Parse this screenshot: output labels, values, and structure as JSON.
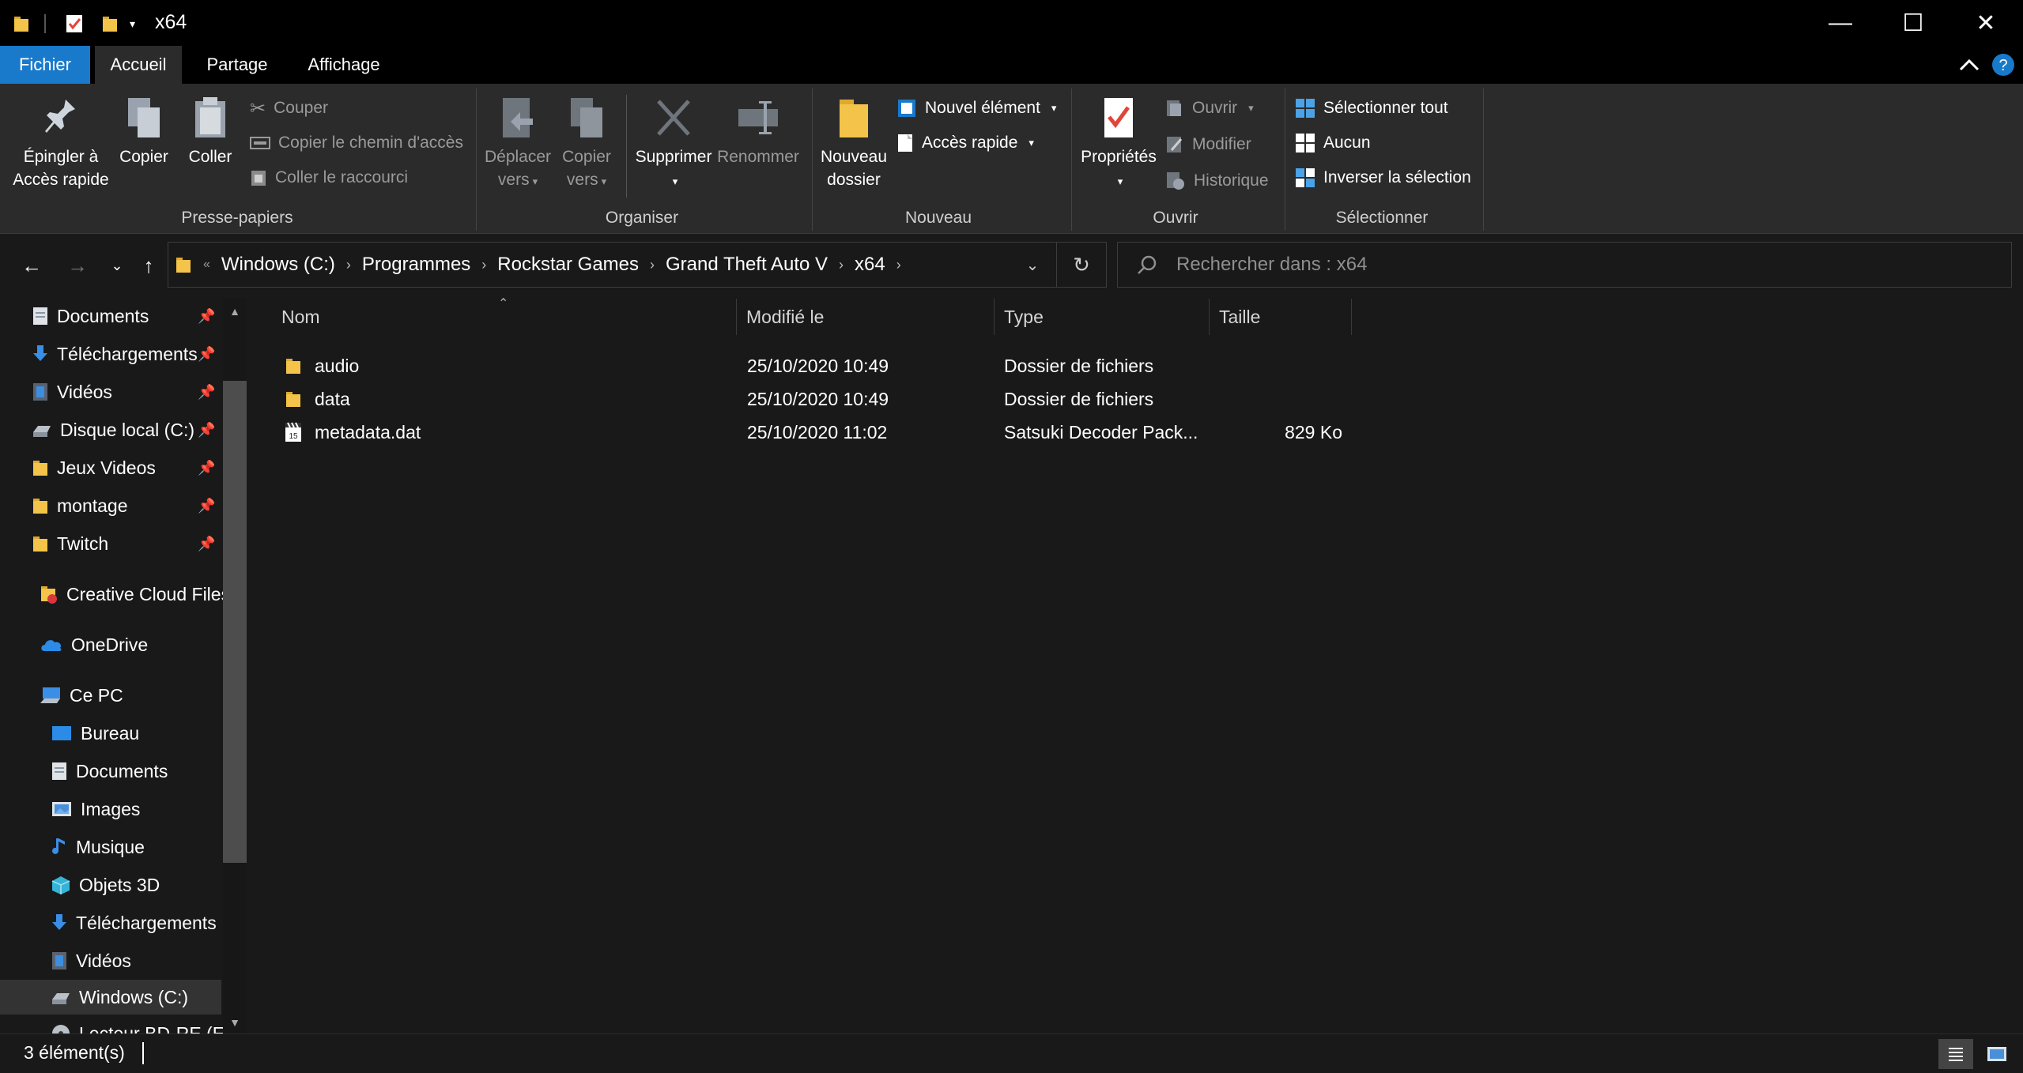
{
  "window": {
    "title": "x64",
    "minimize": "—",
    "maximize": "☐",
    "close": "✕"
  },
  "tabs": {
    "file": "Fichier",
    "home": "Accueil",
    "share": "Partage",
    "view": "Affichage"
  },
  "ribbon": {
    "clipboard": {
      "label": "Presse-papiers",
      "pin_line1": "Épingler à",
      "pin_line2": "Accès rapide",
      "copy": "Copier",
      "paste": "Coller",
      "cut": "Couper",
      "copy_path": "Copier le chemin d'accès",
      "paste_shortcut": "Coller le raccourci"
    },
    "organize": {
      "label": "Organiser",
      "move_line1": "Déplacer",
      "move_line2": "vers",
      "copyto_line1": "Copier",
      "copyto_line2": "vers",
      "delete": "Supprimer",
      "rename": "Renommer"
    },
    "new": {
      "label": "Nouveau",
      "folder_line1": "Nouveau",
      "folder_line2": "dossier",
      "new_item": "Nouvel élément",
      "easy_access": "Accès rapide"
    },
    "open": {
      "label": "Ouvrir",
      "properties": "Propriétés",
      "open": "Ouvrir",
      "edit": "Modifier",
      "history": "Historique"
    },
    "select": {
      "label": "Sélectionner",
      "select_all": "Sélectionner tout",
      "select_none": "Aucun",
      "invert": "Inverser la sélection"
    }
  },
  "address": {
    "crumbs": [
      "Windows (C:)",
      "Programmes",
      "Rockstar Games",
      "Grand Theft Auto V",
      "x64"
    ],
    "search_placeholder": "Rechercher dans : x64"
  },
  "nav": {
    "quick_access": [
      {
        "label": "Documents",
        "icon": "documents-icon"
      },
      {
        "label": "Téléchargements",
        "icon": "downloads-icon"
      },
      {
        "label": "Vidéos",
        "icon": "videos-icon"
      },
      {
        "label": "Disque local (C:)",
        "icon": "drive-icon"
      },
      {
        "label": "Jeux Videos",
        "icon": "folder-icon"
      },
      {
        "label": "montage",
        "icon": "folder-icon"
      },
      {
        "label": "Twitch",
        "icon": "folder-icon"
      }
    ],
    "creative_cloud": "Creative Cloud Files",
    "onedrive": "OneDrive",
    "this_pc": "Ce PC",
    "pc_items": [
      {
        "label": "Bureau",
        "icon": "desktop-icon"
      },
      {
        "label": "Documents",
        "icon": "documents-icon"
      },
      {
        "label": "Images",
        "icon": "pictures-icon"
      },
      {
        "label": "Musique",
        "icon": "music-icon"
      },
      {
        "label": "Objets 3D",
        "icon": "3d-objects-icon"
      },
      {
        "label": "Téléchargements",
        "icon": "downloads-icon"
      },
      {
        "label": "Vidéos",
        "icon": "videos-icon"
      },
      {
        "label": "Windows (C:)",
        "icon": "drive-icon"
      },
      {
        "label": "Lecteur BD-RE (E:)",
        "icon": "disc-drive-icon"
      }
    ]
  },
  "columns": {
    "name": "Nom",
    "modified": "Modifié le",
    "type": "Type",
    "size": "Taille"
  },
  "files": [
    {
      "name": "audio",
      "modified": "25/10/2020 10:49",
      "type": "Dossier de fichiers",
      "size": "",
      "icon": "folder-icon"
    },
    {
      "name": "data",
      "modified": "25/10/2020 10:49",
      "type": "Dossier de fichiers",
      "size": "",
      "icon": "folder-icon"
    },
    {
      "name": "metadata.dat",
      "modified": "25/10/2020 11:02",
      "type": "Satsuki Decoder Pack...",
      "size": "829 Ko",
      "icon": "media-file-icon"
    }
  ],
  "status": {
    "count": "3 élément(s)"
  },
  "colors": {
    "accent": "#1979ca",
    "folder": "#f3c449",
    "background": "#191919",
    "ribbon": "#2b2b2b"
  }
}
